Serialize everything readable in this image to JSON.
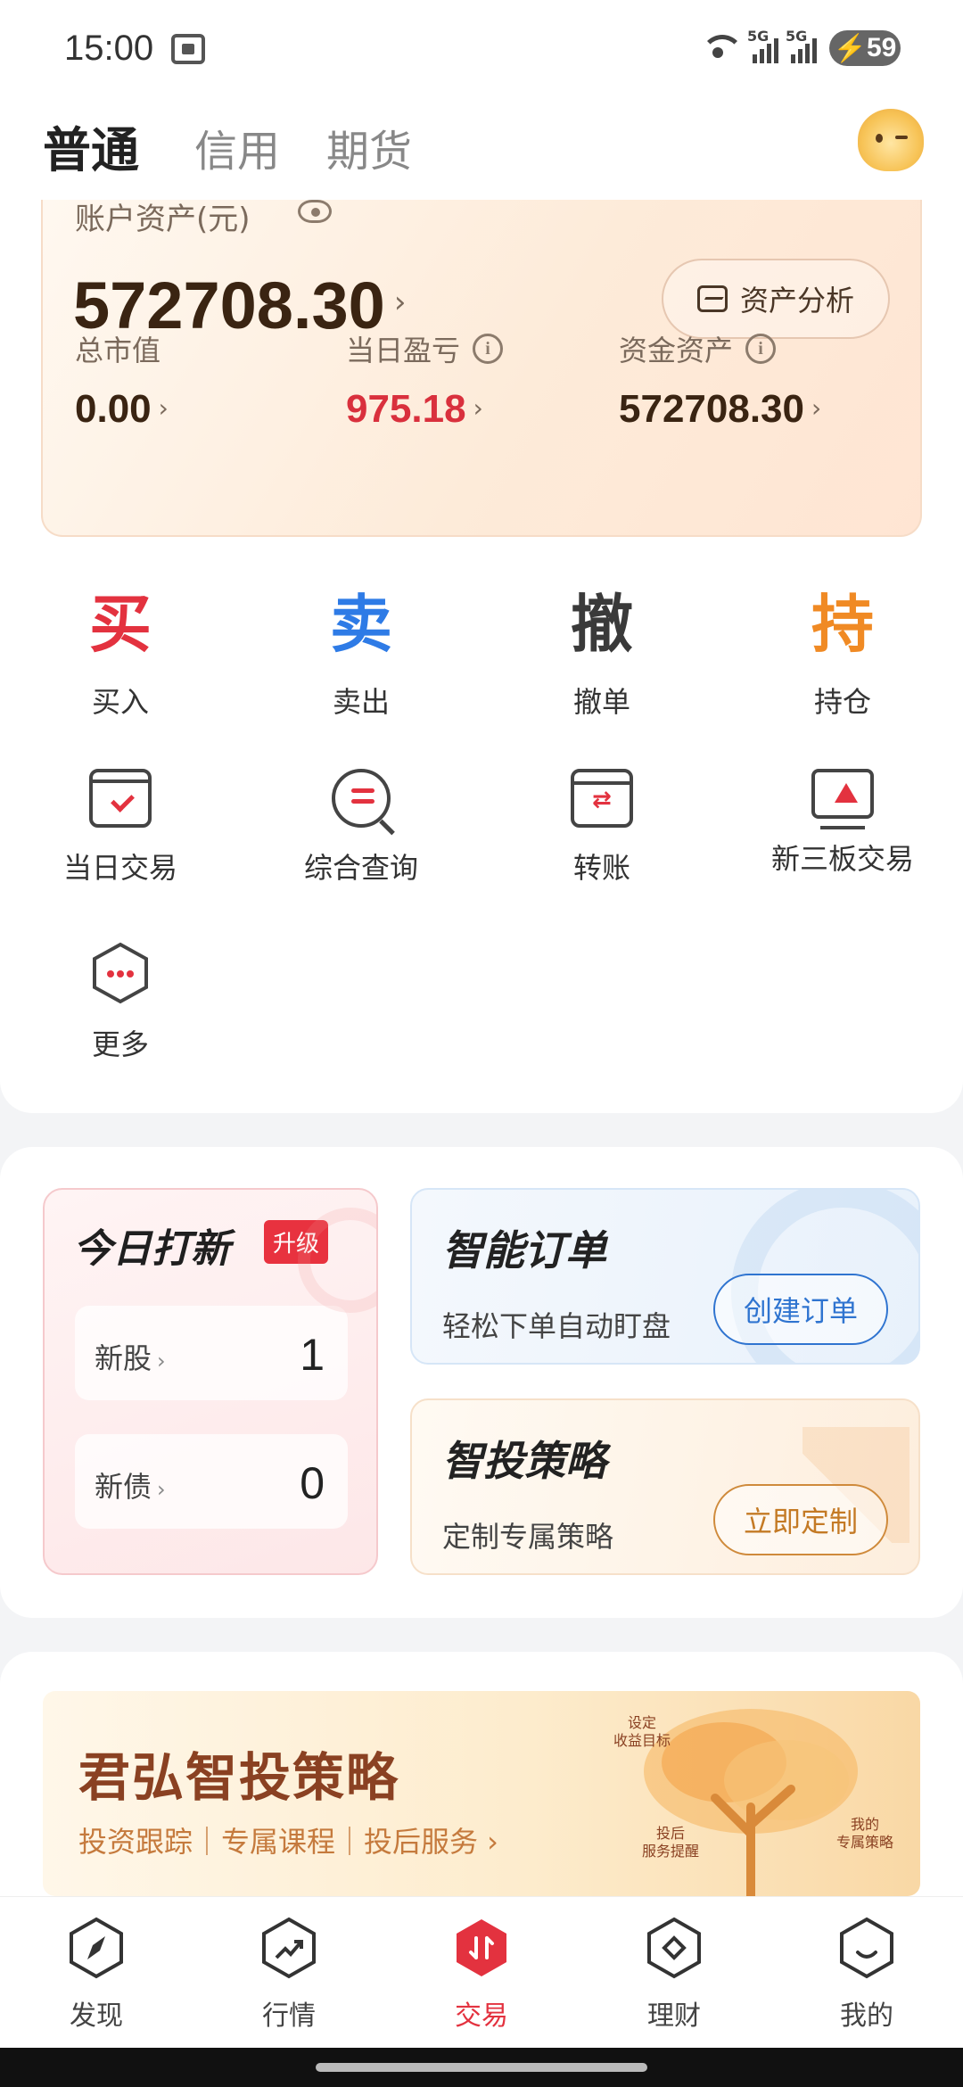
{
  "status_bar": {
    "time": "15:00",
    "battery": "59",
    "net1": "5G",
    "net2": "5G",
    "wifi_tag": "6"
  },
  "top_tabs": [
    "普通",
    "信用",
    "期货"
  ],
  "asset": {
    "label": "账户资产(元)",
    "total": "572708.30",
    "analysis_button": "资产分析",
    "stats": [
      {
        "label": "总市值",
        "value": "0.00"
      },
      {
        "label": "当日盈亏",
        "value": "975.18"
      },
      {
        "label": "资金资产",
        "value": "572708.30"
      }
    ]
  },
  "actions": [
    {
      "glyph": "买",
      "label": "买入",
      "color": "#e3323f"
    },
    {
      "glyph": "卖",
      "label": "卖出",
      "color": "#2e7be6"
    },
    {
      "glyph": "撤",
      "label": "撤单",
      "color": "#333333"
    },
    {
      "glyph": "持",
      "label": "持仓",
      "color": "#f08a24"
    }
  ],
  "tools": [
    "当日交易",
    "综合查询",
    "转账",
    "新三板交易",
    "更多"
  ],
  "ipo": {
    "title": "今日打新",
    "badge": "升级",
    "rows": [
      {
        "label": "新股",
        "value": "1"
      },
      {
        "label": "新债",
        "value": "0"
      }
    ]
  },
  "smart_order": {
    "title": "智能订单",
    "subtitle": "轻松下单自动盯盘",
    "button": "创建订单"
  },
  "strategy": {
    "title": "智投策略",
    "subtitle": "定制专属策略",
    "button": "立即定制"
  },
  "banner": {
    "title": "君弘智投策略",
    "subtitle": "投资跟踪｜专属课程｜投后服务 ›",
    "labels": [
      "设定\n收益目标",
      "投后\n服务提醒",
      "我的\n专属策略"
    ]
  },
  "bottom_nav": [
    "发现",
    "行情",
    "交易",
    "理财",
    "我的"
  ],
  "colors": {
    "accent_red": "#e3323f",
    "accent_blue": "#2e7be6",
    "accent_orange": "#f08a24"
  }
}
